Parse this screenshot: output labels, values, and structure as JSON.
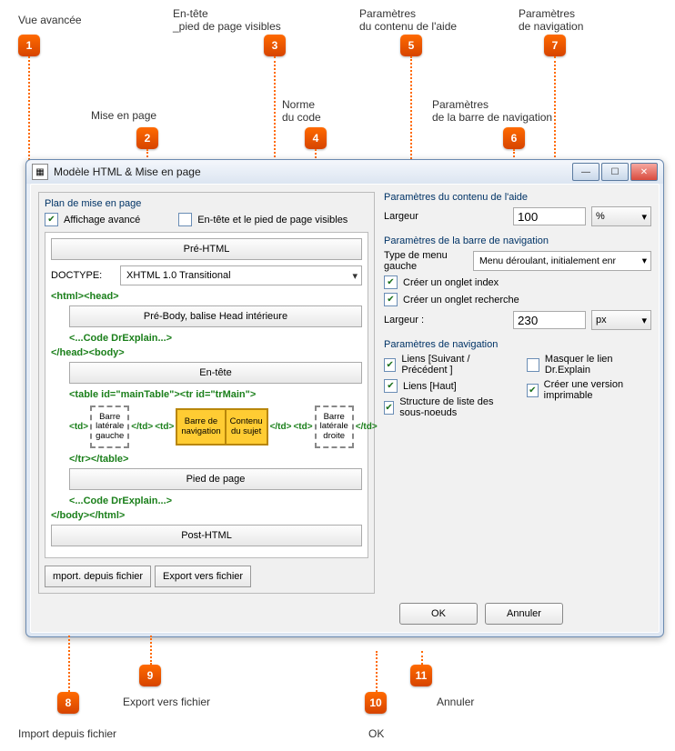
{
  "callouts": {
    "c1": "Vue avancée",
    "c2": "Mise en page",
    "c3": "En-tête\n_pied de page visibles",
    "c4": "Norme\ndu code",
    "c5": "Paramètres\ndu contenu de l'aide",
    "c6": "Paramètres\nde la barre de navigation",
    "c7": "Paramètres\nde navigation",
    "c8": "Import depuis fichier",
    "c9": "Export vers fichier",
    "c10": "OK",
    "c11": "Annuler"
  },
  "window": {
    "title": "Modèle HTML & Mise en page"
  },
  "leftPanel": {
    "section": "Plan de mise en page",
    "advanced": "Affichage avancé",
    "headerFooterVisible": "En-tête et le pied de page visibles",
    "preHtml": "Pré-HTML",
    "doctypeLabel": "DOCTYPE:",
    "doctypeValue": "XHTML 1.0 Transitional",
    "htmlHead": "<html><head>",
    "preBody": "Pré-Body, balise Head intérieure",
    "codeDr1": "<...Code DrExplain...>",
    "headClose": "</head><body>",
    "header": "En-tête",
    "tableOpen": "<table id=\"mainTable\"><tr id=\"trMain\">",
    "td": "<td>",
    "tdClose": "</td>",
    "leftSidebar": "Barre\nlatérale\ngauche",
    "navBar": "Barre de\nnavigation",
    "content": "Contenu\ndu sujet",
    "rightSidebar": "Barre\nlatérale\ndroite",
    "tableClose": "</tr></table>",
    "footer": "Pied de page",
    "codeDr2": "<...Code DrExplain...>",
    "bodyClose": "</body></html>",
    "postHtml": "Post-HTML",
    "importBtn": "mport. depuis fichier",
    "exportBtn": "Export vers fichier"
  },
  "rightPanel": {
    "helpContent": {
      "title": "Paramètres du contenu de l'aide",
      "widthLabel": "Largeur",
      "widthValue": "100",
      "widthUnit": "%"
    },
    "navBar": {
      "title": "Paramètres de la barre de navigation",
      "menuTypeLabel": "Type de menu gauche",
      "menuTypeValue": "Menu déroulant, initialement enr",
      "createIndex": "Créer un onglet index",
      "createSearch": "Créer un onglet recherche",
      "widthLabel": "Largeur :",
      "widthValue": "230",
      "widthUnit": "px"
    },
    "navParams": {
      "title": "Paramètres de navigation",
      "linksNextPrev": "Liens [Suivant / Précédent ]",
      "linksTop": "Liens [Haut]",
      "subnodesList": "Structure de liste des sous-noeuds",
      "hideDrExplain": "Masquer le lien Dr.Explain",
      "printable": "Créer une version imprimable"
    }
  },
  "dialogButtons": {
    "ok": "OK",
    "cancel": "Annuler"
  }
}
